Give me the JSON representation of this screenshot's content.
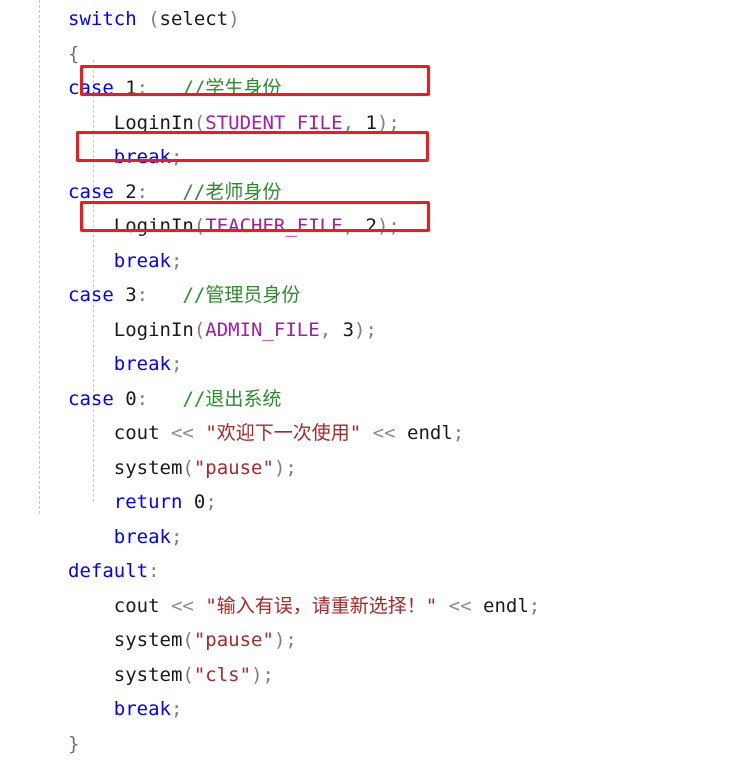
{
  "editor": {
    "language": "C++",
    "background_color": "#ffffff",
    "indent_guide_color": "#c9c9c9",
    "annotation_color": "#fb1717",
    "colors": {
      "keyword": "#0000ff",
      "comment": "#2e8b2e",
      "macro": "#a020a0",
      "string": "#a52a2a",
      "punctuation": "#808080",
      "operator": "#8a8aa0",
      "plain": "#1a1a1a"
    }
  },
  "code": {
    "lines": [
      {
        "id": "line-switch",
        "indent": 0,
        "tokens": [
          {
            "t": "keyword",
            "v": "switch"
          },
          {
            "t": "plain",
            "v": " "
          },
          {
            "t": "punct",
            "v": "("
          },
          {
            "t": "plain",
            "v": "select"
          },
          {
            "t": "punct",
            "v": ")"
          }
        ]
      },
      {
        "id": "line-open-brace",
        "indent": 0,
        "tokens": [
          {
            "t": "brace",
            "v": "{"
          }
        ]
      },
      {
        "id": "line-case-1",
        "indent": 0,
        "tokens": [
          {
            "t": "keyword",
            "v": "case"
          },
          {
            "t": "plain",
            "v": " "
          },
          {
            "t": "number",
            "v": "1"
          },
          {
            "t": "punct",
            "v": ":"
          },
          {
            "t": "plain",
            "v": "   "
          },
          {
            "t": "comment",
            "v": "//学生身份"
          }
        ]
      },
      {
        "id": "line-loginin-student",
        "indent": 1,
        "tokens": [
          {
            "t": "func",
            "v": "LoginIn"
          },
          {
            "t": "punct",
            "v": "("
          },
          {
            "t": "macro",
            "v": "STUDENT_FILE"
          },
          {
            "t": "punct",
            "v": ","
          },
          {
            "t": "plain",
            "v": " "
          },
          {
            "t": "number",
            "v": "1"
          },
          {
            "t": "punct",
            "v": ")"
          },
          {
            "t": "punct",
            "v": ";"
          }
        ]
      },
      {
        "id": "line-break-1",
        "indent": 1,
        "tokens": [
          {
            "t": "keyword",
            "v": "break"
          },
          {
            "t": "punct",
            "v": ";"
          }
        ]
      },
      {
        "id": "line-case-2",
        "indent": 0,
        "tokens": [
          {
            "t": "keyword",
            "v": "case"
          },
          {
            "t": "plain",
            "v": " "
          },
          {
            "t": "number",
            "v": "2"
          },
          {
            "t": "punct",
            "v": ":"
          },
          {
            "t": "plain",
            "v": "   "
          },
          {
            "t": "comment",
            "v": "//老师身份"
          }
        ]
      },
      {
        "id": "line-loginin-teacher",
        "indent": 1,
        "tokens": [
          {
            "t": "func",
            "v": "LoginIn"
          },
          {
            "t": "punct",
            "v": "("
          },
          {
            "t": "macro",
            "v": "TEACHER_FILE"
          },
          {
            "t": "punct",
            "v": ","
          },
          {
            "t": "plain",
            "v": " "
          },
          {
            "t": "number",
            "v": "2"
          },
          {
            "t": "punct",
            "v": ")"
          },
          {
            "t": "punct",
            "v": ";"
          }
        ]
      },
      {
        "id": "line-break-2",
        "indent": 1,
        "tokens": [
          {
            "t": "keyword",
            "v": "break"
          },
          {
            "t": "punct",
            "v": ";"
          }
        ]
      },
      {
        "id": "line-case-3",
        "indent": 0,
        "tokens": [
          {
            "t": "keyword",
            "v": "case"
          },
          {
            "t": "plain",
            "v": " "
          },
          {
            "t": "number",
            "v": "3"
          },
          {
            "t": "punct",
            "v": ":"
          },
          {
            "t": "plain",
            "v": "   "
          },
          {
            "t": "comment",
            "v": "//管理员身份"
          }
        ]
      },
      {
        "id": "line-loginin-admin",
        "indent": 1,
        "tokens": [
          {
            "t": "func",
            "v": "LoginIn"
          },
          {
            "t": "punct",
            "v": "("
          },
          {
            "t": "macro",
            "v": "ADMIN_FILE"
          },
          {
            "t": "punct",
            "v": ","
          },
          {
            "t": "plain",
            "v": " "
          },
          {
            "t": "number",
            "v": "3"
          },
          {
            "t": "punct",
            "v": ")"
          },
          {
            "t": "punct",
            "v": ";"
          }
        ]
      },
      {
        "id": "line-break-3",
        "indent": 1,
        "tokens": [
          {
            "t": "keyword",
            "v": "break"
          },
          {
            "t": "punct",
            "v": ";"
          }
        ]
      },
      {
        "id": "line-case-0",
        "indent": 0,
        "tokens": [
          {
            "t": "keyword",
            "v": "case"
          },
          {
            "t": "plain",
            "v": " "
          },
          {
            "t": "number",
            "v": "0"
          },
          {
            "t": "punct",
            "v": ":"
          },
          {
            "t": "plain",
            "v": "   "
          },
          {
            "t": "comment",
            "v": "//退出系统"
          }
        ]
      },
      {
        "id": "line-cout-welcome",
        "indent": 1,
        "tokens": [
          {
            "t": "plain",
            "v": "cout"
          },
          {
            "t": "plain",
            "v": " "
          },
          {
            "t": "operator",
            "v": "<<"
          },
          {
            "t": "plain",
            "v": " "
          },
          {
            "t": "string",
            "v": "\"欢迎下一次使用\""
          },
          {
            "t": "plain",
            "v": " "
          },
          {
            "t": "operator",
            "v": "<<"
          },
          {
            "t": "plain",
            "v": " "
          },
          {
            "t": "plain",
            "v": "endl"
          },
          {
            "t": "punct",
            "v": ";"
          }
        ]
      },
      {
        "id": "line-system-pause-1",
        "indent": 1,
        "tokens": [
          {
            "t": "func",
            "v": "system"
          },
          {
            "t": "punct",
            "v": "("
          },
          {
            "t": "string",
            "v": "\"pause\""
          },
          {
            "t": "punct",
            "v": ")"
          },
          {
            "t": "punct",
            "v": ";"
          }
        ]
      },
      {
        "id": "line-return-0",
        "indent": 1,
        "tokens": [
          {
            "t": "keyword",
            "v": "return"
          },
          {
            "t": "plain",
            "v": " "
          },
          {
            "t": "number",
            "v": "0"
          },
          {
            "t": "punct",
            "v": ";"
          }
        ]
      },
      {
        "id": "line-break-4",
        "indent": 1,
        "tokens": [
          {
            "t": "keyword",
            "v": "break"
          },
          {
            "t": "punct",
            "v": ";"
          }
        ]
      },
      {
        "id": "line-default",
        "indent": 0,
        "tokens": [
          {
            "t": "keyword",
            "v": "default"
          },
          {
            "t": "punct",
            "v": ":"
          }
        ]
      },
      {
        "id": "line-cout-error",
        "indent": 1,
        "tokens": [
          {
            "t": "plain",
            "v": "cout"
          },
          {
            "t": "plain",
            "v": " "
          },
          {
            "t": "operator",
            "v": "<<"
          },
          {
            "t": "plain",
            "v": " "
          },
          {
            "t": "string",
            "v": "\"输入有误，请重新选择！\""
          },
          {
            "t": "plain",
            "v": " "
          },
          {
            "t": "operator",
            "v": "<<"
          },
          {
            "t": "plain",
            "v": " "
          },
          {
            "t": "plain",
            "v": "endl"
          },
          {
            "t": "punct",
            "v": ";"
          }
        ]
      },
      {
        "id": "line-system-pause-2",
        "indent": 1,
        "tokens": [
          {
            "t": "func",
            "v": "system"
          },
          {
            "t": "punct",
            "v": "("
          },
          {
            "t": "string",
            "v": "\"pause\""
          },
          {
            "t": "punct",
            "v": ")"
          },
          {
            "t": "punct",
            "v": ";"
          }
        ]
      },
      {
        "id": "line-system-cls",
        "indent": 1,
        "tokens": [
          {
            "t": "func",
            "v": "system"
          },
          {
            "t": "punct",
            "v": "("
          },
          {
            "t": "string",
            "v": "\"cls\""
          },
          {
            "t": "punct",
            "v": ")"
          },
          {
            "t": "punct",
            "v": ";"
          }
        ]
      },
      {
        "id": "line-break-5",
        "indent": 1,
        "tokens": [
          {
            "t": "keyword",
            "v": "break"
          },
          {
            "t": "punct",
            "v": ";"
          }
        ]
      },
      {
        "id": "line-close-brace",
        "indent": 0,
        "tokens": [
          {
            "t": "brace",
            "v": "}"
          }
        ]
      }
    ]
  },
  "annotations": [
    {
      "id": "annotation-box-1",
      "target_line": "line-loginin-student",
      "label": "LoginIn(STUDENT_FILE, 1);"
    },
    {
      "id": "annotation-box-2",
      "target_line": "line-loginin-teacher",
      "label": "LoginIn(TEACHER_FILE, 2);"
    },
    {
      "id": "annotation-box-3",
      "target_line": "line-loginin-admin",
      "label": "LoginIn(ADMIN_FILE, 3);"
    }
  ]
}
